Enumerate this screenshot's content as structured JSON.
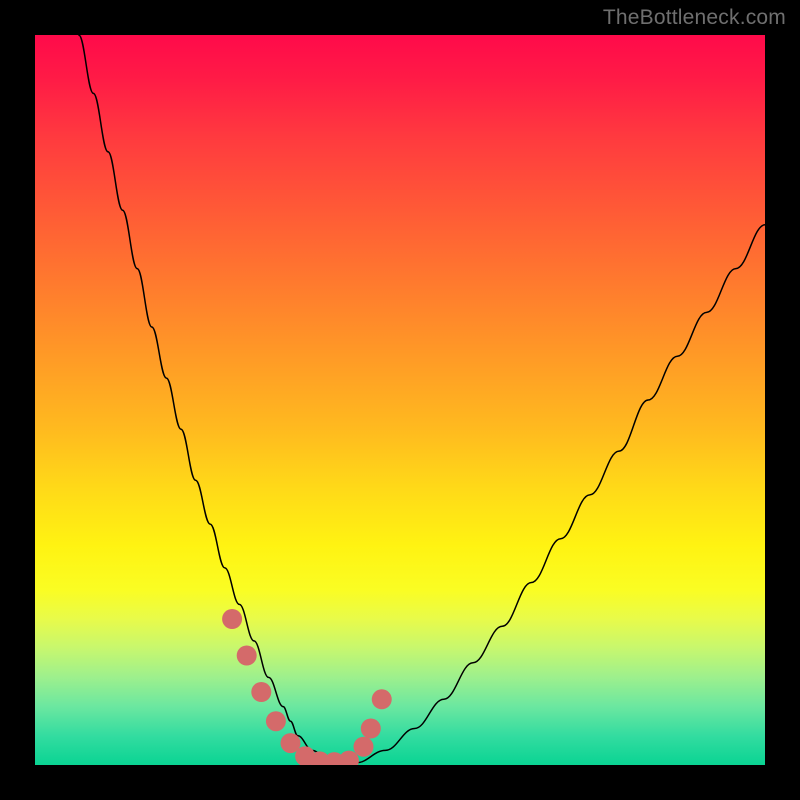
{
  "watermark": {
    "text": "TheBottleneck.com"
  },
  "chart_data": {
    "type": "line",
    "title": "",
    "xlabel": "",
    "ylabel": "",
    "xlim": [
      0,
      100
    ],
    "ylim": [
      0,
      100
    ],
    "grid": false,
    "legend": false,
    "background_gradient": {
      "direction": "vertical",
      "stops": [
        {
          "pos": 0.0,
          "color": "#ff0a4a"
        },
        {
          "pos": 0.24,
          "color": "#ff5a36"
        },
        {
          "pos": 0.54,
          "color": "#ffba1f"
        },
        {
          "pos": 0.7,
          "color": "#fff312"
        },
        {
          "pos": 0.84,
          "color": "#c7f76e"
        },
        {
          "pos": 1.0,
          "color": "#0ad493"
        }
      ]
    },
    "series": [
      {
        "name": "bottleneck-curve",
        "color": "#000000",
        "width": 1.5,
        "x": [
          6,
          8,
          10,
          12,
          14,
          16,
          18,
          20,
          22,
          24,
          26,
          28,
          30,
          32,
          34,
          35,
          36,
          38,
          40,
          42,
          44,
          48,
          52,
          56,
          60,
          64,
          68,
          72,
          76,
          80,
          84,
          88,
          92,
          96,
          100
        ],
        "y": [
          100,
          92,
          84,
          76,
          68,
          60,
          53,
          46,
          39,
          33,
          27,
          22,
          17,
          12,
          8,
          6,
          4,
          2,
          0.8,
          0.2,
          0.3,
          2,
          5,
          9,
          14,
          19,
          25,
          31,
          37,
          43,
          50,
          56,
          62,
          68,
          74
        ]
      },
      {
        "name": "highlight-dots",
        "color": "#d46a6a",
        "marker": "circle",
        "marker_size": 10,
        "x": [
          27,
          29,
          31,
          33,
          35,
          37,
          39,
          41,
          43,
          45,
          46,
          47.5
        ],
        "y": [
          20,
          15,
          10,
          6,
          3,
          1.2,
          0.5,
          0.4,
          0.6,
          2.5,
          5,
          9
        ]
      }
    ]
  }
}
